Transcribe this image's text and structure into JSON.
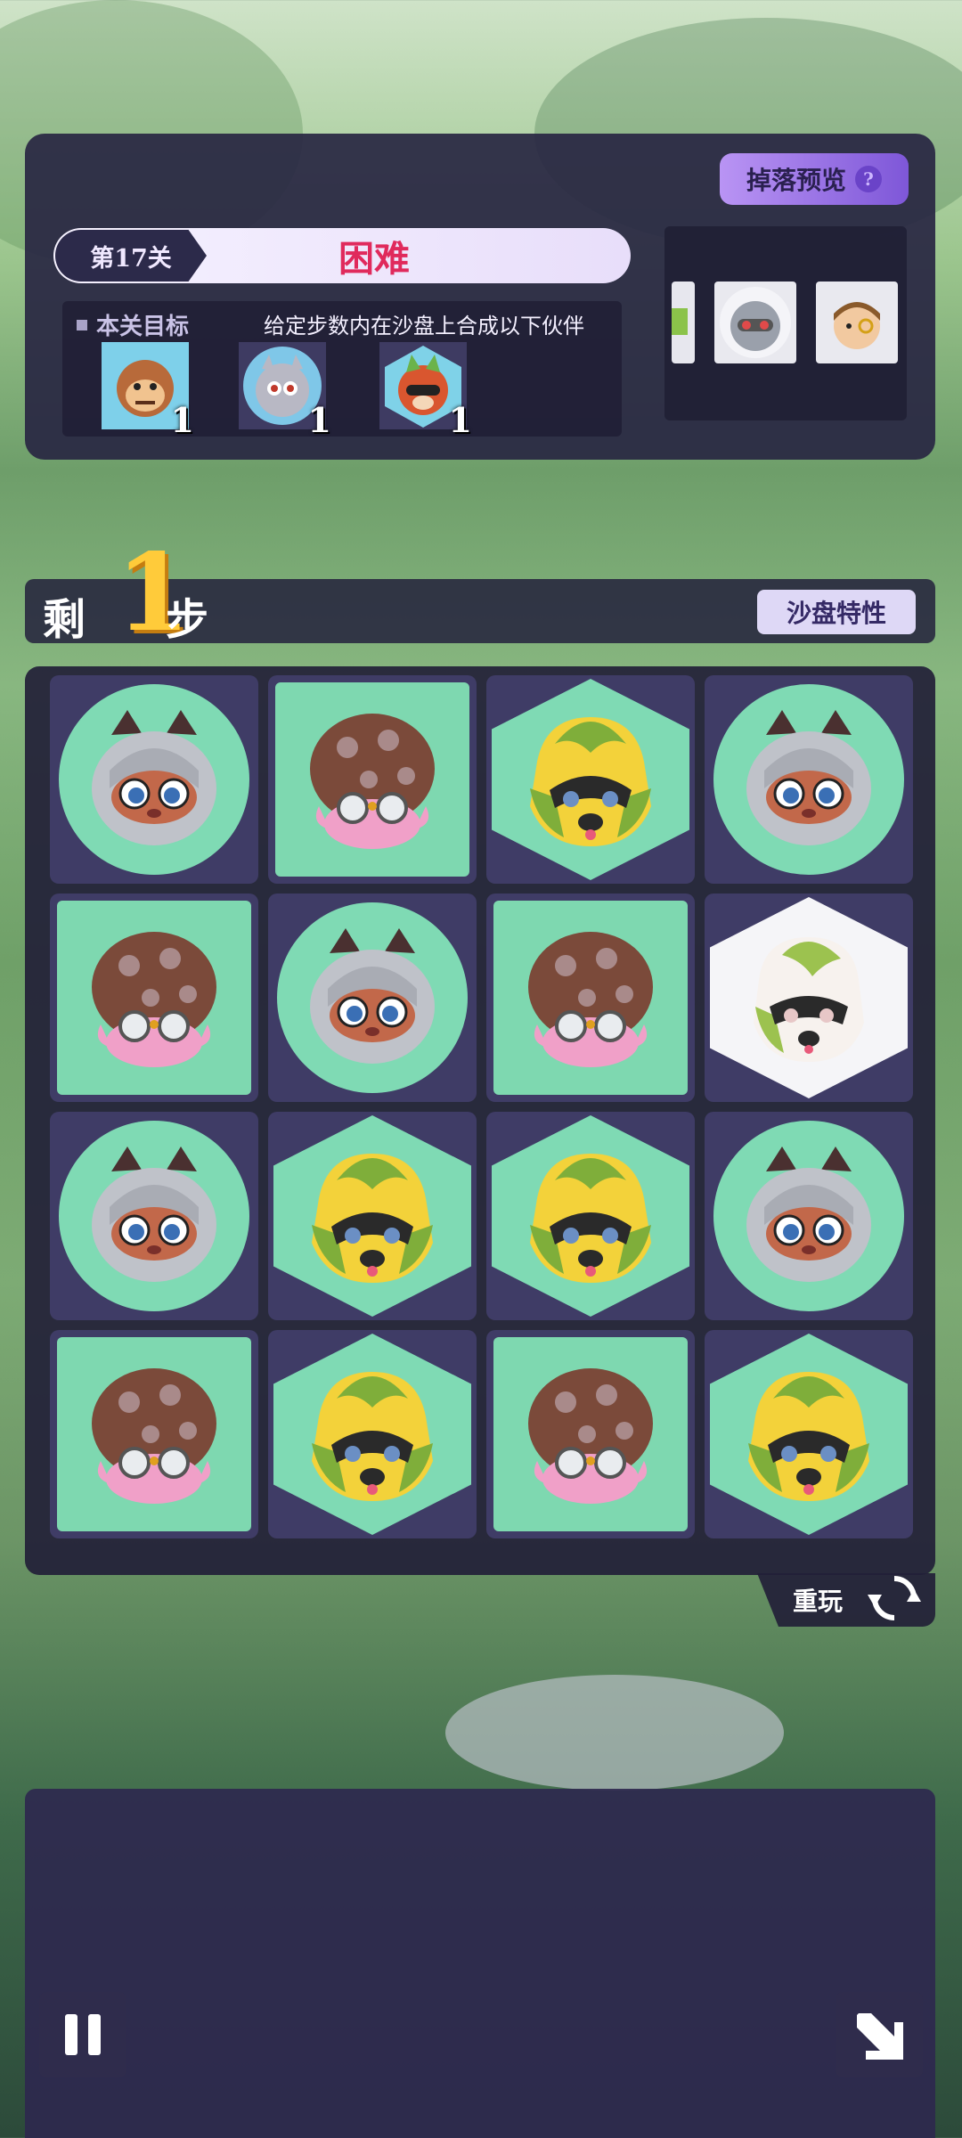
{
  "header": {
    "drop_preview_label": "掉落预览",
    "help_symbol": "?",
    "level_label": "第17关",
    "difficulty": "困难",
    "goal_title": "本关目标",
    "goal_description": "给定步数内在沙盘上合成以下伙伴",
    "goals": [
      {
        "character": "monkey-face",
        "count": "1"
      },
      {
        "character": "gray-cat-face",
        "count": "1"
      },
      {
        "character": "red-fox-face",
        "count": "1"
      }
    ],
    "preview_items": [
      "green-cat-face",
      "gray-cat-face",
      "monocle-boy-face"
    ]
  },
  "steps": {
    "prefix": "剩",
    "remaining": "1",
    "suffix": "步",
    "feature_label": "沙盘特性"
  },
  "board": {
    "rows": [
      [
        {
          "shape": "circle",
          "character": "rock-cat"
        },
        {
          "shape": "square",
          "character": "mushroom-glasses"
        },
        {
          "shape": "hex",
          "character": "leaf-leopard"
        },
        {
          "shape": "circle",
          "character": "rock-cat"
        }
      ],
      [
        {
          "shape": "square",
          "character": "mushroom-glasses"
        },
        {
          "shape": "circle",
          "character": "rock-cat"
        },
        {
          "shape": "square",
          "character": "mushroom-glasses"
        },
        {
          "shape": "hexwhite",
          "character": "white-cat"
        }
      ],
      [
        {
          "shape": "circle",
          "character": "rock-cat"
        },
        {
          "shape": "hex",
          "character": "leaf-leopard"
        },
        {
          "shape": "hex",
          "character": "leaf-leopard"
        },
        {
          "shape": "circle",
          "character": "rock-cat"
        }
      ],
      [
        {
          "shape": "square",
          "character": "mushroom-glasses"
        },
        {
          "shape": "hex",
          "character": "leaf-leopard"
        },
        {
          "shape": "square",
          "character": "mushroom-glasses"
        },
        {
          "shape": "hex",
          "character": "leaf-leopard"
        }
      ]
    ]
  },
  "replay_label": "重玩",
  "controls": {
    "pause_icon": "pause-icon",
    "exit_icon": "exit-arrow-icon"
  },
  "colors": {
    "difficulty": "#e02a5c",
    "steps_number": "#ffcb3a",
    "tile_green": "#7fdab4",
    "panel": "#28263f"
  }
}
